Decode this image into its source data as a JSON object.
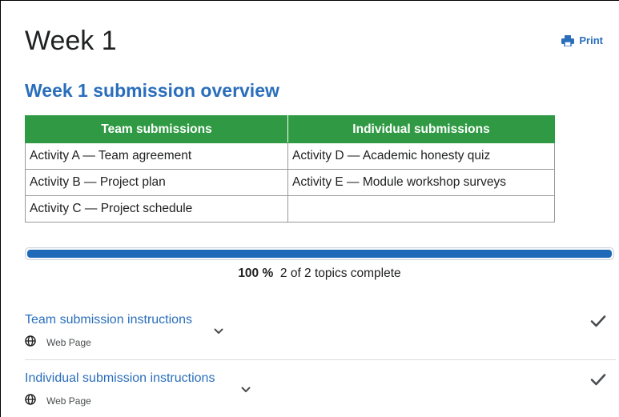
{
  "page": {
    "title": "Week 1",
    "print_label": "Print"
  },
  "overview": {
    "heading": "Week 1 submission overview",
    "columns": [
      "Team submissions",
      "Individual submissions"
    ],
    "rows": [
      [
        "Activity A — Team agreement",
        "Activity D — Academic honesty quiz"
      ],
      [
        "Activity B — Project plan",
        "Activity E — Module workshop surveys"
      ],
      [
        "Activity C — Project schedule",
        ""
      ]
    ]
  },
  "progress": {
    "percent_label": "100 %",
    "summary": "2 of 2 topics complete",
    "fraction": 1.0
  },
  "topics": [
    {
      "title": "Team submission instructions",
      "type": "Web Page",
      "type_icon": "globe-icon",
      "status_icon": "checkmark-icon",
      "complete": true
    },
    {
      "title": "Individual submission instructions",
      "type": "Web Page",
      "type_icon": "globe-icon",
      "status_icon": "checkmark-icon",
      "complete": true
    }
  ],
  "colors": {
    "link": "#2a6ebb",
    "table_header": "#2f9a43",
    "progress": "#1f69b9"
  }
}
